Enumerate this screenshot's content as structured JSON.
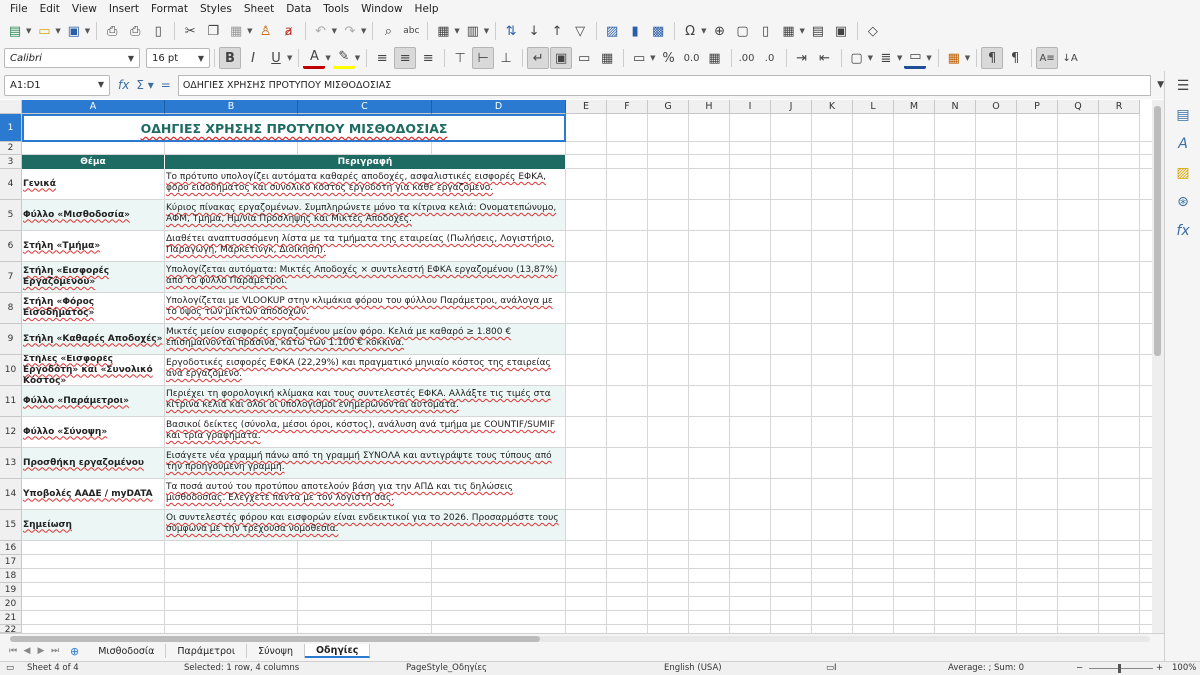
{
  "menu": [
    "File",
    "Edit",
    "View",
    "Insert",
    "Format",
    "Styles",
    "Sheet",
    "Data",
    "Tools",
    "Window",
    "Help"
  ],
  "font": {
    "name": "Calibri",
    "size": "16 pt"
  },
  "namebox": "A1:D1",
  "formula": "ΟΔΗΓΙΕΣ ΧΡΗΣΗΣ ΠΡΟΤΥΠΟΥ ΜΙΣΘΟΔΟΣΙΑΣ",
  "columns": [
    "A",
    "B",
    "C",
    "D",
    "E",
    "F",
    "G",
    "H",
    "I",
    "J",
    "K",
    "L",
    "M",
    "N",
    "O",
    "P",
    "Q",
    "R"
  ],
  "rows": [
    "1",
    "2",
    "3",
    "4",
    "5",
    "6",
    "7",
    "8",
    "9",
    "10",
    "11",
    "12",
    "13",
    "14",
    "15",
    "16",
    "17",
    "18",
    "19",
    "20",
    "21",
    "22"
  ],
  "title": "ΟΔΗΓΙΕΣ ΧΡΗΣΗΣ ΠΡΟΤΥΠΟΥ ΜΙΣΘΟΔΟΣΙΑΣ",
  "table_header": {
    "topic": "Θέμα",
    "description": "Περιγραφή"
  },
  "entries": [
    {
      "topic": "Γενικά",
      "description": "Το πρότυπο υπολογίζει αυτόματα καθαρές αποδοχές, ασφαλιστικές εισφορές ΕΦΚΑ, φόρο εισοδήματος και συνολικό κόστος εργοδότη για κάθε εργαζόμενο."
    },
    {
      "topic": "Φύλλο «Μισθοδοσία»",
      "description": "Κύριος πίνακας εργαζομένων. Συμπληρώνετε μόνο τα κίτρινα κελιά: Ονοματεπώνυμο, ΑΦΜ, Τμήμα, Ημ/νία Πρόσληψης και Μικτές Αποδοχές."
    },
    {
      "topic": "Στήλη «Τμήμα»",
      "description": "Διαθέτει αναπτυσσόμενη λίστα με τα τμήματα της εταιρείας (Πωλήσεις, Λογιστήριο, Παραγωγή, Μάρκετινγκ, Διοίκηση)."
    },
    {
      "topic": "Στήλη «Εισφορές Εργαζόμενου»",
      "description": "Υπολογίζεται αυτόματα: Μικτές Αποδοχές × συντελεστή ΕΦΚΑ εργαζομένου (13,87%) από το φύλλο Παράμετροι."
    },
    {
      "topic": "Στήλη «Φόρος Εισοδήματος»",
      "description": "Υπολογίζεται με VLOOKUP στην κλιμάκια φόρου του φύλλου Παράμετροι, ανάλογα με το ύψος των μικτών αποδοχών."
    },
    {
      "topic": "Στήλη «Καθαρές Αποδοχές»",
      "description": "Μικτές μείον εισφορές εργαζομένου μείον φόρο. Κελιά με καθαρό ≥ 1.800 € επισημαίνονται πράσινα, κάτω των 1.100 € κόκκινα."
    },
    {
      "topic": "Στήλες «Εισφορές Εργοδότη» και «Συνολικό Κόστος»",
      "description": "Εργοδοτικές εισφορές ΕΦΚΑ (22,29%) και πραγματικό μηνιαίο κόστος της εταιρείας ανά εργαζόμενο."
    },
    {
      "topic": "Φύλλο «Παράμετροι»",
      "description": "Περιέχει τη φορολογική κλίμακα και τους συντελεστές ΕΦΚΑ. Αλλάξτε τις τιμές στα κίτρινα κελιά και όλοι οι υπολογισμοί ενημερώνονται αυτόματα."
    },
    {
      "topic": "Φύλλο «Σύνοψη»",
      "description": "Βασικοί δείκτες (σύνολα, μέσοι όροι, κόστος), ανάλυση ανά τμήμα με COUNTIF/SUMIF και τρία γραφήματα."
    },
    {
      "topic": "Προσθήκη εργαζομένου",
      "description": "Εισάγετε νέα γραμμή πάνω από τη γραμμή ΣΥΝΟΛΑ και αντιγράψτε τους τύπους από την προηγούμενη γραμμή."
    },
    {
      "topic": "Υποβολές ΑΑΔΕ / myDATA",
      "description": "Τα ποσά αυτού του προτύπου αποτελούν βάση για την ΑΠΔ και τις δηλώσεις μισθοδοσίας. Ελέγχετε πάντα με τον λογιστή σας."
    },
    {
      "topic": "Σημείωση",
      "description": "Οι συντελεστές φόρου και εισφορών είναι ενδεικτικοί για το 2026. Προσαρμόστε τους σύμφωνα με την τρέχουσα νομοθεσία."
    }
  ],
  "tabs": [
    "Μισθοδοσία",
    "Παράμετροι",
    "Σύνοψη",
    "Οδηγίες"
  ],
  "active_tab": "Οδηγίες",
  "status": {
    "sheet": "Sheet 4 of 4",
    "selection": "Selected: 1 row, 4 columns",
    "pagestyle": "PageStyle_Οδηγίες",
    "language": "English (USA)",
    "summary": "Average: ; Sum: 0",
    "zoom": "100%"
  },
  "colors": {
    "header_teal": "#1e6b64",
    "selection_blue": "#2a7ad2",
    "alt_row": "#ecf7f5"
  }
}
